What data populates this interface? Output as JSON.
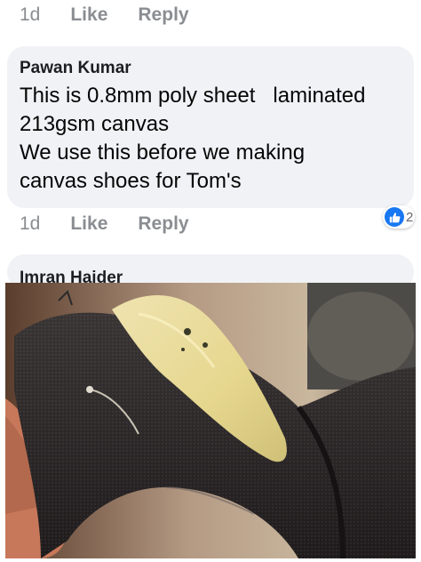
{
  "top_actions": {
    "time": "1d",
    "like": "Like",
    "reply": "Reply"
  },
  "comment": {
    "author": "Pawan Kumar",
    "text": "This is 0.8mm poly sheet   laminated\n213gsm canvas\nWe use this before we making\ncanvas shoes for Tom's",
    "actions": {
      "time": "1d",
      "like": "Like",
      "reply": "Reply"
    },
    "reaction": {
      "icon": "like-icon",
      "count": "2"
    }
  },
  "next_comment": {
    "author": "Imran Haider"
  },
  "photo": {
    "description_icon": "attached-photo"
  }
}
